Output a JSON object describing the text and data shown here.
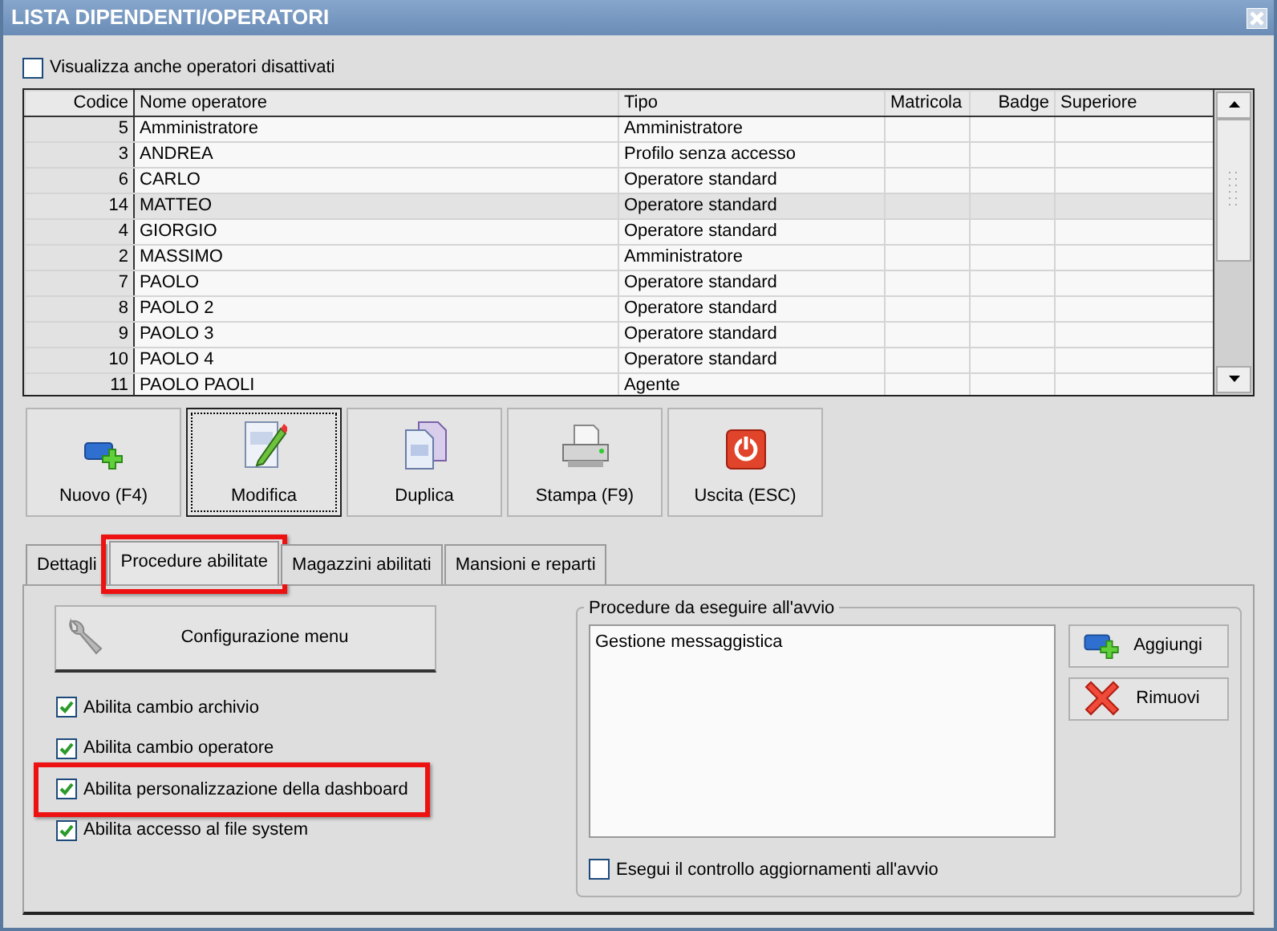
{
  "window": {
    "title": "LISTA DIPENDENTI/OPERATORI"
  },
  "show_disabled": {
    "label": "Visualizza anche operatori disattivati",
    "checked": false
  },
  "table": {
    "columns": [
      "Codice",
      "Nome operatore",
      "Tipo",
      "Matricola",
      "Badge",
      "Superiore"
    ],
    "rows": [
      {
        "code": "5",
        "name": "Amministratore",
        "type": "Amministratore",
        "selected": false
      },
      {
        "code": "3",
        "name": "ANDREA",
        "type": "Profilo senza accesso",
        "selected": false
      },
      {
        "code": "6",
        "name": "CARLO",
        "type": "Operatore standard",
        "selected": false
      },
      {
        "code": "14",
        "name": "MATTEO",
        "type": "Operatore standard",
        "selected": true
      },
      {
        "code": "4",
        "name": "GIORGIO",
        "type": "Operatore standard",
        "selected": false
      },
      {
        "code": "2",
        "name": "MASSIMO",
        "type": "Amministratore",
        "selected": false
      },
      {
        "code": "7",
        "name": "PAOLO",
        "type": "Operatore standard",
        "selected": false
      },
      {
        "code": "8",
        "name": "PAOLO 2",
        "type": "Operatore standard",
        "selected": false
      },
      {
        "code": "9",
        "name": "PAOLO 3",
        "type": "Operatore standard",
        "selected": false
      },
      {
        "code": "10",
        "name": "PAOLO 4",
        "type": "Operatore standard",
        "selected": false
      },
      {
        "code": "11",
        "name": "PAOLO PAOLI",
        "type": "Agente",
        "selected": false
      }
    ]
  },
  "toolbar": [
    {
      "label": "Nuovo (F4)",
      "kind": "new",
      "focused": false
    },
    {
      "label": "Modifica",
      "kind": "edit",
      "focused": true
    },
    {
      "label": "Duplica",
      "kind": "duplicate",
      "focused": false
    },
    {
      "label": "Stampa (F9)",
      "kind": "print",
      "focused": false
    },
    {
      "label": "Uscita (ESC)",
      "kind": "exit",
      "focused": false
    }
  ],
  "tabs": [
    {
      "label": "Dettagli",
      "selected": false,
      "highlighted": false
    },
    {
      "label": "Procedure abilitate",
      "selected": true,
      "highlighted": true
    },
    {
      "label": "Magazzini abilitati",
      "selected": false,
      "highlighted": false
    },
    {
      "label": "Mansioni e reparti",
      "selected": false,
      "highlighted": false
    }
  ],
  "config_button": {
    "label": "Configurazione menu"
  },
  "permissions": [
    {
      "label": "Abilita cambio archivio",
      "checked": true,
      "highlighted": false
    },
    {
      "label": "Abilita cambio operatore",
      "checked": true,
      "highlighted": false
    },
    {
      "label": "Abilita personalizzazione della dashboard",
      "checked": true,
      "highlighted": true
    },
    {
      "label": "Abilita accesso al file system",
      "checked": true,
      "highlighted": false
    }
  ],
  "startup": {
    "title": "Procedure da eseguire all'avvio",
    "items": [
      "Gestione messaggistica"
    ],
    "buttons": [
      {
        "label": "Aggiungi",
        "kind": "add"
      },
      {
        "label": "Rimuovi",
        "kind": "remove"
      }
    ],
    "check_updates": {
      "label": "Esegui il controllo aggiornamenti all'avvio",
      "checked": false
    }
  }
}
